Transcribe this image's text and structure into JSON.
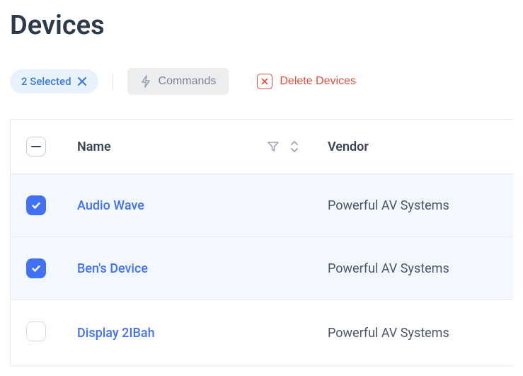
{
  "page": {
    "title": "Devices"
  },
  "toolbar": {
    "selected_label": "2 Selected",
    "commands_label": "Commands",
    "delete_label": "Delete Devices"
  },
  "table": {
    "columns": {
      "name": "Name",
      "vendor": "Vendor"
    },
    "rows": [
      {
        "name": "Audio Wave",
        "vendor": "Powerful AV Systems",
        "selected": true
      },
      {
        "name": "Ben's Device",
        "vendor": "Powerful AV Systems",
        "selected": true
      },
      {
        "name": "Display 2IBah",
        "vendor": "Powerful AV Systems",
        "selected": false
      }
    ]
  }
}
